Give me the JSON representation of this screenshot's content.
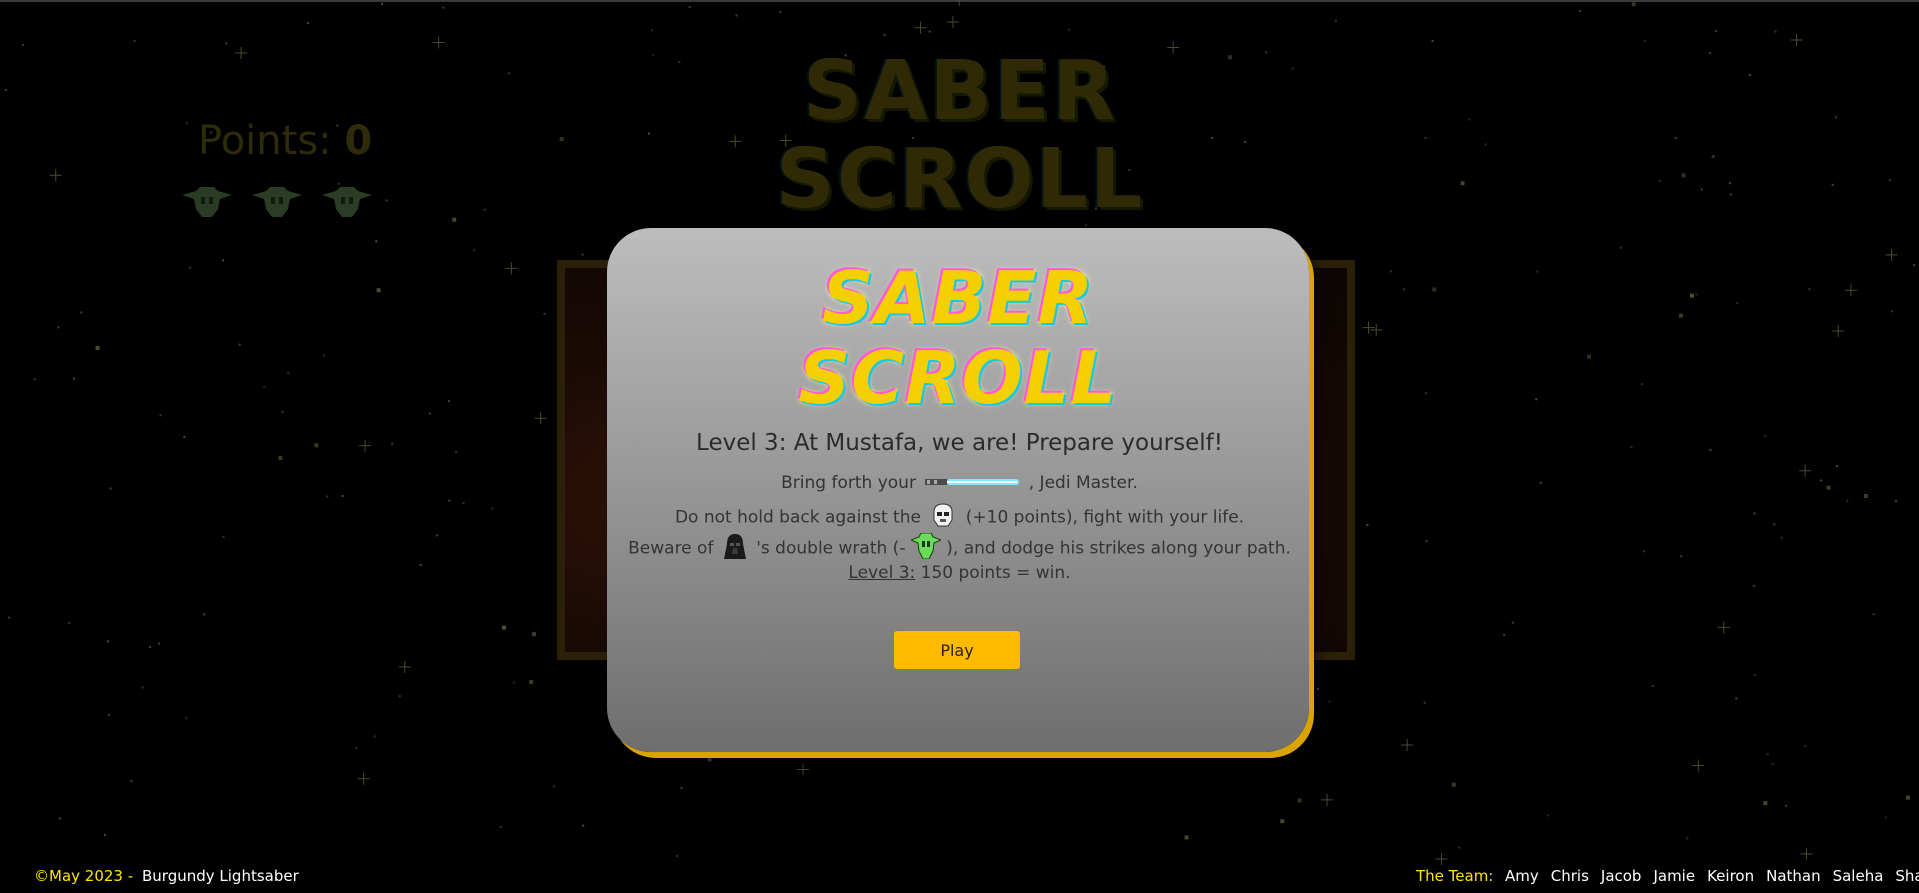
{
  "background": {
    "title_line1": "SABER",
    "title_line2": "SCROLL",
    "points_label": "Points:",
    "points_value": "0",
    "lives_count": 3
  },
  "modal": {
    "logo_line1": "SABER",
    "logo_line2": "SCROLL",
    "level_title": "Level 3: At Mustafa, we are! Prepare yourself!",
    "line1_pre": "Bring forth your",
    "line1_post": ", Jedi Master.",
    "line2_pre": "Do not hold back against the",
    "line2_post": "(+10 points), fight with your life.",
    "line3_pre": "Beware of",
    "line3_mid": "'s double wrath (-",
    "line3_post": "), and dodge his strikes along your path.",
    "line4_label": "Level 3:",
    "line4_rest": "150 points = win.",
    "play_label": "Play",
    "icons": [
      "lightsaber-icon",
      "stormtrooper-icon",
      "darth-vader-icon",
      "yoda-life-icon"
    ]
  },
  "footer": {
    "copyright": "©May 2023 -",
    "brand": "Burgundy Lightsaber",
    "team_label": "The Team:",
    "team": [
      "Amy",
      "Chris",
      "Jacob",
      "Jamie",
      "Keiron",
      "Nathan",
      "Saleha",
      "Shaun"
    ]
  },
  "colors": {
    "accent_yellow": "#fdbb00",
    "footer_yellow": "#ffe600",
    "modal_border": "#d9a400"
  }
}
